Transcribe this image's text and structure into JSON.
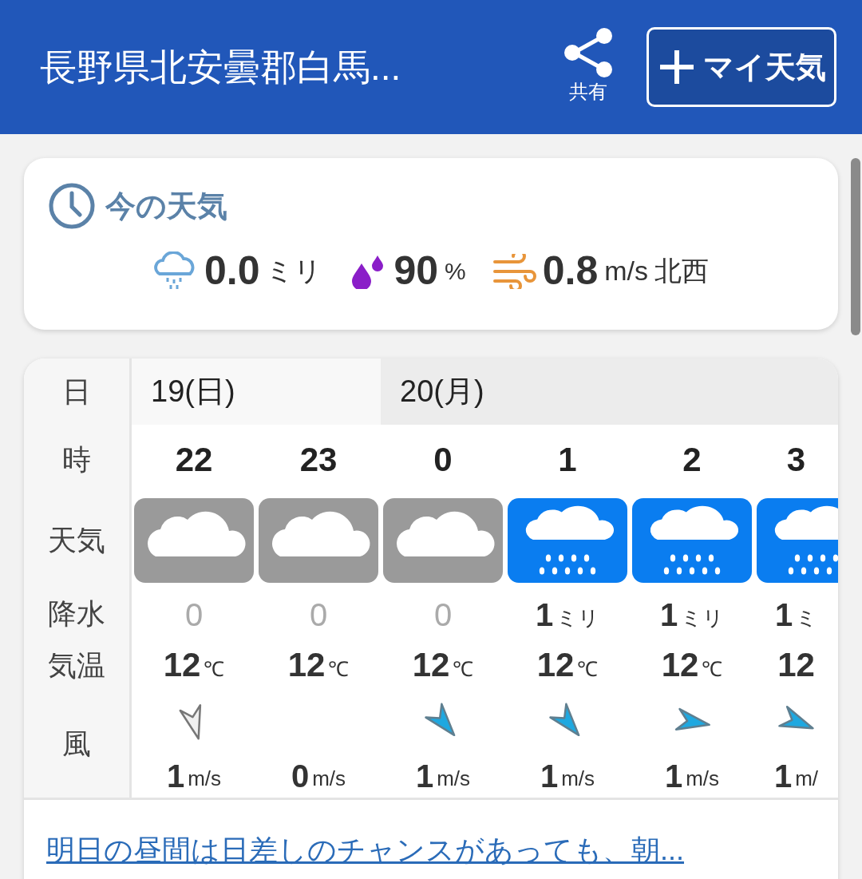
{
  "header": {
    "title": "長野県北安曇郡白馬...",
    "share_label": "共有",
    "my_weather_button": "マイ天気"
  },
  "current": {
    "title": "今の天気",
    "precip": {
      "value": "0.0",
      "unit": "ミリ"
    },
    "humidity": {
      "value": "90",
      "unit": "%"
    },
    "wind": {
      "value": "0.8",
      "unit": "m/s",
      "direction": "北西"
    }
  },
  "forecast": {
    "row_labels": {
      "day": "日",
      "hour": "時",
      "weather": "天気",
      "precip": "降水",
      "temp": "気温",
      "wind": "風"
    },
    "days": [
      {
        "label": "19(日)",
        "hours": [
          {
            "hour": "22",
            "weather": {
              "kind": "cloudy"
            },
            "precip": {
              "kind": "none",
              "value": "0"
            },
            "temp": {
              "value": "12",
              "unit": "℃"
            },
            "wind": {
              "kind": "calm",
              "arrow": {
                "kind": "south"
              },
              "speed": "1",
              "unit": "m/s"
            }
          },
          {
            "hour": "23",
            "weather": {
              "kind": "cloudy"
            },
            "precip": {
              "kind": "none",
              "value": "0"
            },
            "temp": {
              "value": "12",
              "unit": "℃"
            },
            "wind": {
              "speed": "0",
              "unit": "m/s"
            }
          }
        ]
      },
      {
        "label": "20(月)",
        "hours": [
          {
            "hour": "0",
            "weather": {
              "kind": "cloudy"
            },
            "precip": {
              "kind": "none",
              "value": "0"
            },
            "temp": {
              "value": "12",
              "unit": "℃"
            },
            "wind": {
              "kind": "wind",
              "arrow": {
                "kind": "southeast"
              },
              "speed": "1",
              "unit": "m/s"
            }
          },
          {
            "hour": "1",
            "weather": {
              "kind": "rain"
            },
            "precip": {
              "kind": "rain",
              "value": "1",
              "unit": "ミリ"
            },
            "temp": {
              "value": "12",
              "unit": "℃"
            },
            "wind": {
              "kind": "wind",
              "arrow": {
                "kind": "southeast"
              },
              "speed": "1",
              "unit": "m/s"
            }
          },
          {
            "hour": "2",
            "weather": {
              "kind": "rain"
            },
            "precip": {
              "kind": "rain",
              "value": "1",
              "unit": "ミリ"
            },
            "temp": {
              "value": "12",
              "unit": "℃"
            },
            "wind": {
              "kind": "wind",
              "arrow": {
                "kind": "east"
              },
              "speed": "1",
              "unit": "m/s"
            }
          },
          {
            "hour": "3",
            "weather": {
              "kind": "rain"
            },
            "precip": {
              "kind": "rain",
              "value": "1",
              "unit": "ミ"
            },
            "temp": {
              "value": "12"
            },
            "wind": {
              "kind": "wind",
              "arrow": {
                "kind": "eastsoutheast"
              },
              "speed": "1",
              "unit": "m/"
            }
          }
        ]
      }
    ]
  },
  "link": "明日の昼間は日差しのチャンスがあっても、朝..."
}
